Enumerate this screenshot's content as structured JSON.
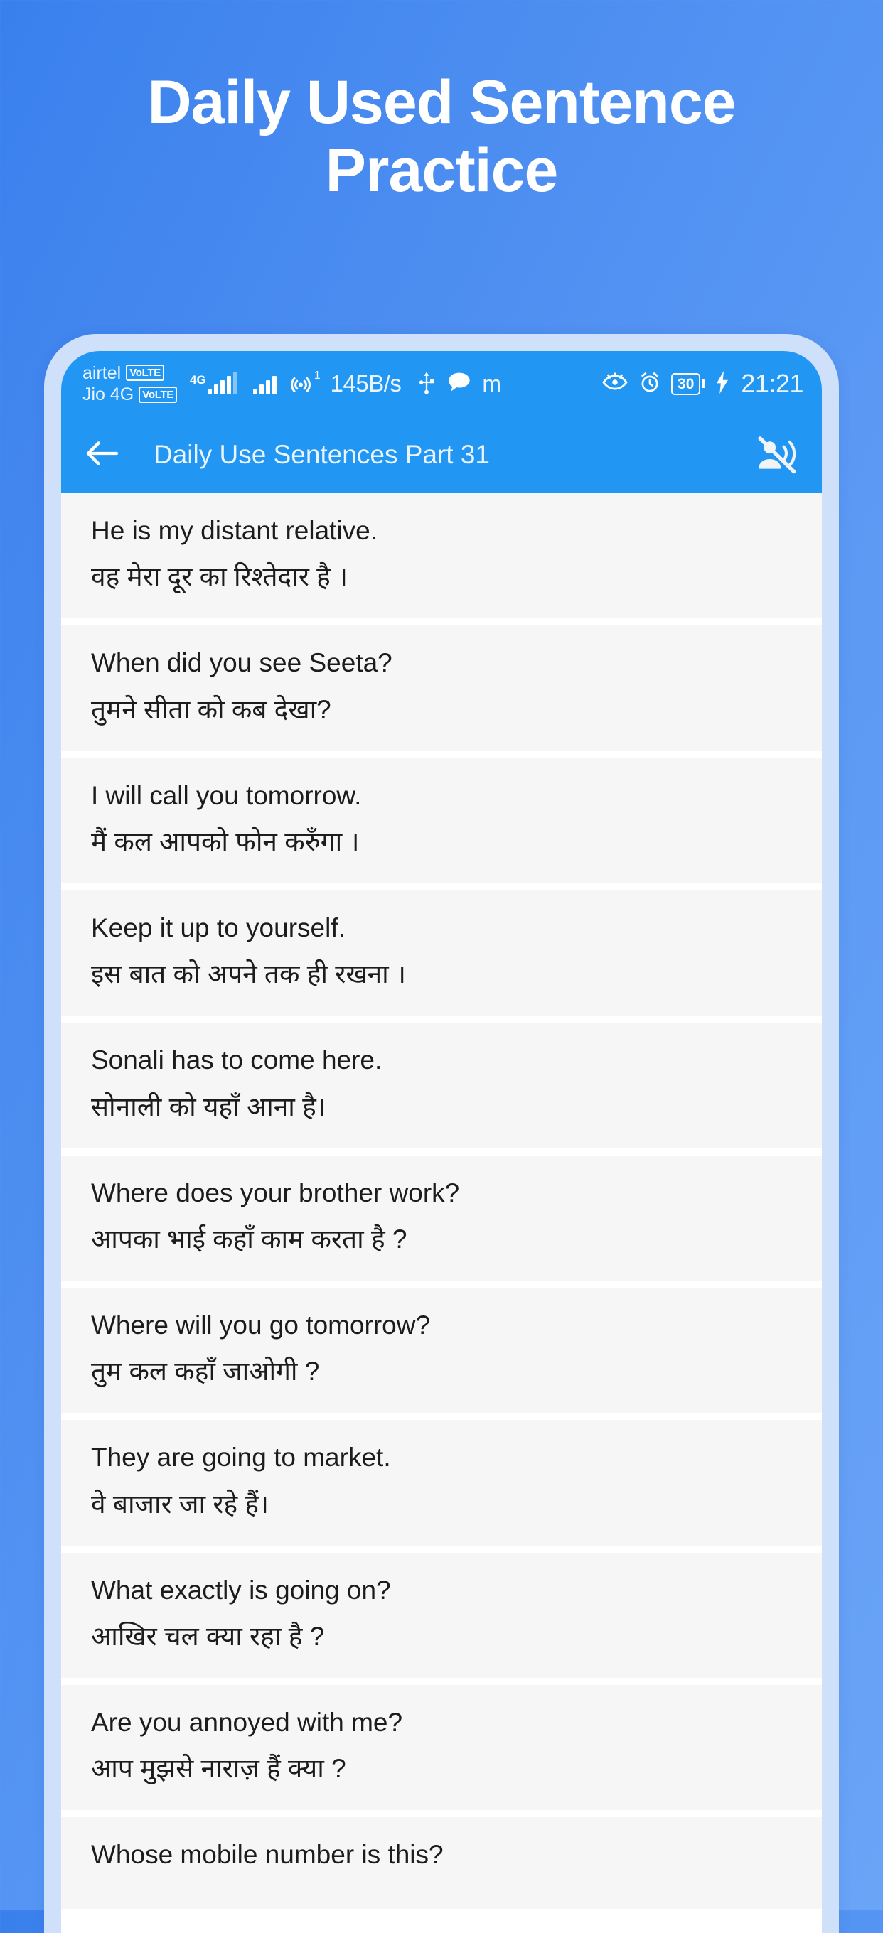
{
  "promo": {
    "headline": "Daily Used Sentence Practice"
  },
  "statusbar": {
    "carrier_1": "airtel",
    "carrier_1_badge": "VoLTE",
    "carrier_2": "Jio 4G",
    "carrier_2_badge": "VoLTE",
    "network_label": "4G",
    "hotspot_count": "1",
    "net_speed": "145B/s",
    "usb_icon": "usb-icon",
    "chat_icon": "chat-bubble-icon",
    "moj_glyph": "m",
    "eye_icon": "eye-protection-icon",
    "alarm_icon": "alarm-clock-icon",
    "battery_level": "30",
    "charging_icon": "charging-bolt-icon",
    "time": "21:21"
  },
  "appbar": {
    "back_icon": "back-arrow-icon",
    "title": "Daily Use Sentences Part 31",
    "mute_icon": "voice-over-off-icon"
  },
  "sentences": [
    {
      "en": "He is my distant relative.",
      "hi": "वह मेरा दूर का रिश्तेदार है ।"
    },
    {
      "en": "When did you see Seeta?",
      "hi": "तुमने सीता को कब देखा?"
    },
    {
      "en": "I will call you tomorrow.",
      "hi": "मैं कल आपको फोन करुँगा ।"
    },
    {
      "en": "Keep it up to yourself.",
      "hi": "इस बात को अपने तक ही रखना ।"
    },
    {
      "en": "Sonali has to come here.",
      "hi": "सोनाली को यहाँ आना है।"
    },
    {
      "en": "Where does your brother work?",
      "hi": "आपका भाई कहाँ काम करता है ?"
    },
    {
      "en": "Where will you go tomorrow?",
      "hi": "तुम कल कहाँ जाओगी ?"
    },
    {
      "en": "They are going to market.",
      "hi": "वे बाजार जा रहे हैं।"
    },
    {
      "en": "What exactly is going on?",
      "hi": "आखिर चल क्या रहा है ?"
    },
    {
      "en": "Are you annoyed with me?",
      "hi": "आप मुझसे नाराज़ हैं क्या ?"
    },
    {
      "en": "Whose mobile number is this?",
      "hi": ""
    }
  ],
  "colors": {
    "bg_gradient_start": "#3a80ed",
    "bg_gradient_end": "#6aa4f7",
    "phone_bezel": "#cfe0fb",
    "app_accent": "#2196f3",
    "row_bg": "#f6f6f6",
    "text_primary": "#1c1c1c",
    "heading_text": "#ffffff"
  }
}
